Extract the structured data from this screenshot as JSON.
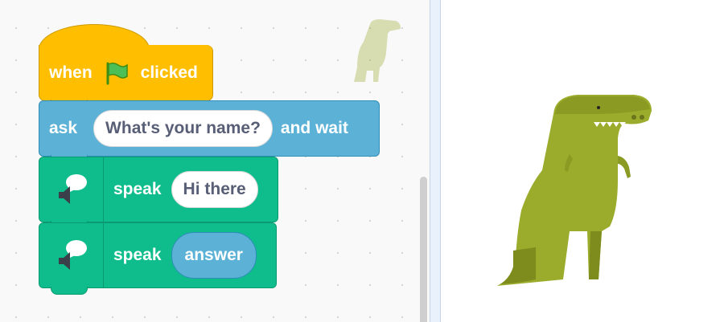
{
  "workspace": {
    "blocks": {
      "hat": {
        "label_when": "when",
        "flag_icon": "green-flag-icon",
        "label_clicked": "clicked"
      },
      "ask": {
        "label": "ask",
        "input": "What's your name?",
        "label_after": "and wait"
      },
      "speak1": {
        "label": "speak",
        "input": "Hi there",
        "icon": "speech-speaker-icon"
      },
      "speak2": {
        "label": "speak",
        "reporter": "answer",
        "icon": "speech-speaker-icon"
      }
    }
  },
  "colors": {
    "events": "#ffbf00",
    "sensing": "#5cb1d6",
    "extension": "#0fbd8c",
    "dino": "#9bab2b"
  },
  "stage": {
    "sprite": "t-rex-sprite"
  }
}
